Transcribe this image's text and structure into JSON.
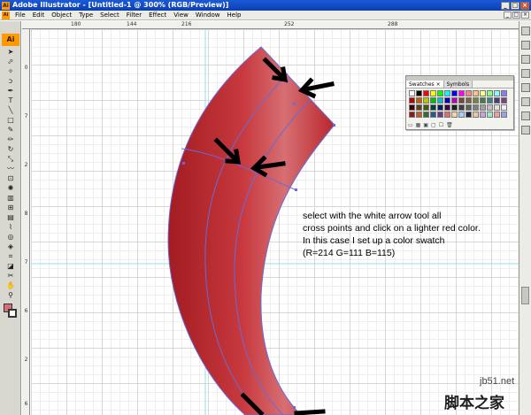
{
  "window": {
    "title": "Adobe Illustrator - [Untitled-1 @ 300% (RGB/Preview)]",
    "app_icon": "Ai",
    "buttons": [
      "_",
      "□",
      "×"
    ],
    "doc_buttons": [
      "_",
      "□",
      "×"
    ]
  },
  "menu": {
    "items": [
      "File",
      "Edit",
      "Object",
      "Type",
      "Select",
      "Filter",
      "Effect",
      "View",
      "Window",
      "Help"
    ]
  },
  "toolbox": {
    "logo": "Ai",
    "tools": [
      {
        "name": "selection-tool-icon",
        "glyph": "➤"
      },
      {
        "name": "direct-selection-tool-icon",
        "glyph": "⬀"
      },
      {
        "name": "magic-wand-icon",
        "glyph": "✧"
      },
      {
        "name": "lasso-icon",
        "glyph": "ↄ"
      },
      {
        "name": "pen-tool-icon",
        "glyph": "✒"
      },
      {
        "name": "type-tool-icon",
        "glyph": "T"
      },
      {
        "name": "line-tool-icon",
        "glyph": "╲"
      },
      {
        "name": "rectangle-tool-icon",
        "glyph": "□"
      },
      {
        "name": "paintbrush-icon",
        "glyph": "✎"
      },
      {
        "name": "pencil-icon",
        "glyph": "✏"
      },
      {
        "name": "rotate-tool-icon",
        "glyph": "↻"
      },
      {
        "name": "scale-tool-icon",
        "glyph": "⤡"
      },
      {
        "name": "warp-tool-icon",
        "glyph": "〰"
      },
      {
        "name": "free-transform-icon",
        "glyph": "⊡"
      },
      {
        "name": "symbol-sprayer-icon",
        "glyph": "✺"
      },
      {
        "name": "graph-tool-icon",
        "glyph": "▥"
      },
      {
        "name": "mesh-tool-icon",
        "glyph": "⊞"
      },
      {
        "name": "gradient-tool-icon",
        "glyph": "▤"
      },
      {
        "name": "eyedropper-icon",
        "glyph": "⌇"
      },
      {
        "name": "blend-tool-icon",
        "glyph": "◎"
      },
      {
        "name": "live-paint-icon",
        "glyph": "◈"
      },
      {
        "name": "slice-tool-icon",
        "glyph": "⌗"
      },
      {
        "name": "eraser-icon",
        "glyph": "◪"
      },
      {
        "name": "scissors-icon",
        "glyph": "✂"
      },
      {
        "name": "hand-tool-icon",
        "glyph": "✋"
      },
      {
        "name": "zoom-tool-icon",
        "glyph": "⚲"
      }
    ],
    "fill_color": "#d66f73"
  },
  "rulers": {
    "top": [
      "180",
      "144",
      "216",
      "252",
      "288"
    ],
    "left": [
      "0",
      "7",
      "2",
      "8",
      "7",
      "6",
      "2",
      "6"
    ]
  },
  "swatches_panel": {
    "tabs": [
      "Swatches ×",
      "Symbols"
    ],
    "colors": [
      "#ffffff",
      "#000000",
      "#ff0000",
      "#ffff00",
      "#00ff00",
      "#00ffff",
      "#0000ff",
      "#ff00ff",
      "#ff8080",
      "#ffc080",
      "#ffff80",
      "#80ff80",
      "#80ffff",
      "#8080ff",
      "#c00000",
      "#c06000",
      "#c0c000",
      "#00c000",
      "#00c0c0",
      "#0000c0",
      "#c000c0",
      "#804040",
      "#806040",
      "#808040",
      "#408040",
      "#408080",
      "#404080",
      "#804080",
      "#400000",
      "#604020",
      "#406000",
      "#004040",
      "#002060",
      "#400040",
      "#202020",
      "#404040",
      "#606060",
      "#808080",
      "#a0a0a0",
      "#c0c0c0",
      "#e0e0e0",
      "#f0f0f0",
      "#8b1a1a",
      "#c85a2a",
      "#3a6a3a",
      "#2a5a8a",
      "#6a3a8a",
      "#d66f73",
      "#fbd0a0",
      "#a0d0fb",
      "#202040",
      "#e8c8a0",
      "#c8a0e8",
      "#a0e8c8",
      "#e8a0a0",
      "#a0a0e8"
    ],
    "bottom_icons": [
      "▭",
      "▦",
      "▣",
      "▢",
      "☐",
      "🗑"
    ]
  },
  "instructions": {
    "line1": "select with the white arrow tool all",
    "line2": "cross points and click on a lighter red color.",
    "line3": "In this case I set up a color swatch",
    "line4": "(R=214 G=111 B=115)"
  },
  "shape": {
    "dark_red": "#b8262b",
    "light_red": "#d66f73",
    "path_color": "#6a6ad8"
  },
  "watermark": {
    "url": "jb51.net",
    "cn": "脚本之家"
  }
}
